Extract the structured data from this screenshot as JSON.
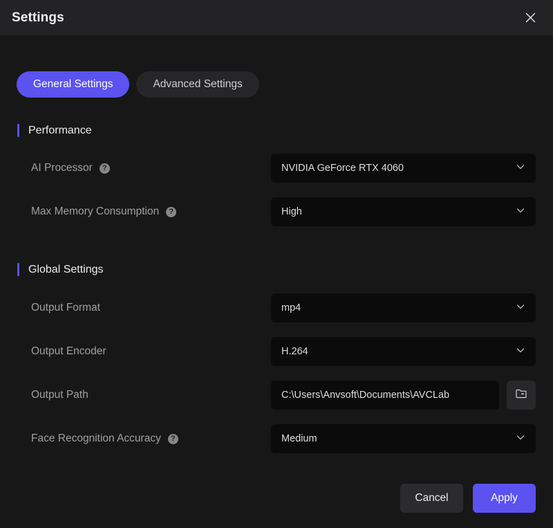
{
  "window": {
    "title": "Settings",
    "close_icon": "close-icon"
  },
  "colors": {
    "accent": "#5b52f0",
    "titlebar_bg": "#232325",
    "body_bg": "#171718",
    "field_bg": "#0b0b0c",
    "tab_inactive_bg": "#262628",
    "label_text": "#a0a0a4"
  },
  "tabs": [
    {
      "label": "General Settings",
      "active": true
    },
    {
      "label": "Advanced Settings",
      "active": false
    }
  ],
  "sections": [
    {
      "title": "Performance",
      "rows": [
        {
          "label": "AI Processor",
          "help": true,
          "help_glyph": "?",
          "control": "dropdown",
          "value": "NVIDIA GeForce RTX 4060"
        },
        {
          "label": "Max Memory Consumption",
          "help": true,
          "help_glyph": "?",
          "control": "dropdown",
          "value": "High"
        }
      ]
    },
    {
      "title": "Global Settings",
      "rows": [
        {
          "label": "Output Format",
          "help": false,
          "control": "dropdown",
          "value": "mp4"
        },
        {
          "label": "Output Encoder",
          "help": false,
          "control": "dropdown",
          "value": "H.264"
        },
        {
          "label": "Output Path",
          "help": false,
          "control": "path",
          "value": "C:\\Users\\Anvsoft\\Documents\\AVCLab",
          "browse_icon": "folder-icon"
        },
        {
          "label": "Face Recognition Accuracy",
          "help": true,
          "help_glyph": "?",
          "control": "dropdown",
          "value": "Medium"
        }
      ]
    }
  ],
  "footer": {
    "cancel_label": "Cancel",
    "apply_label": "Apply"
  }
}
